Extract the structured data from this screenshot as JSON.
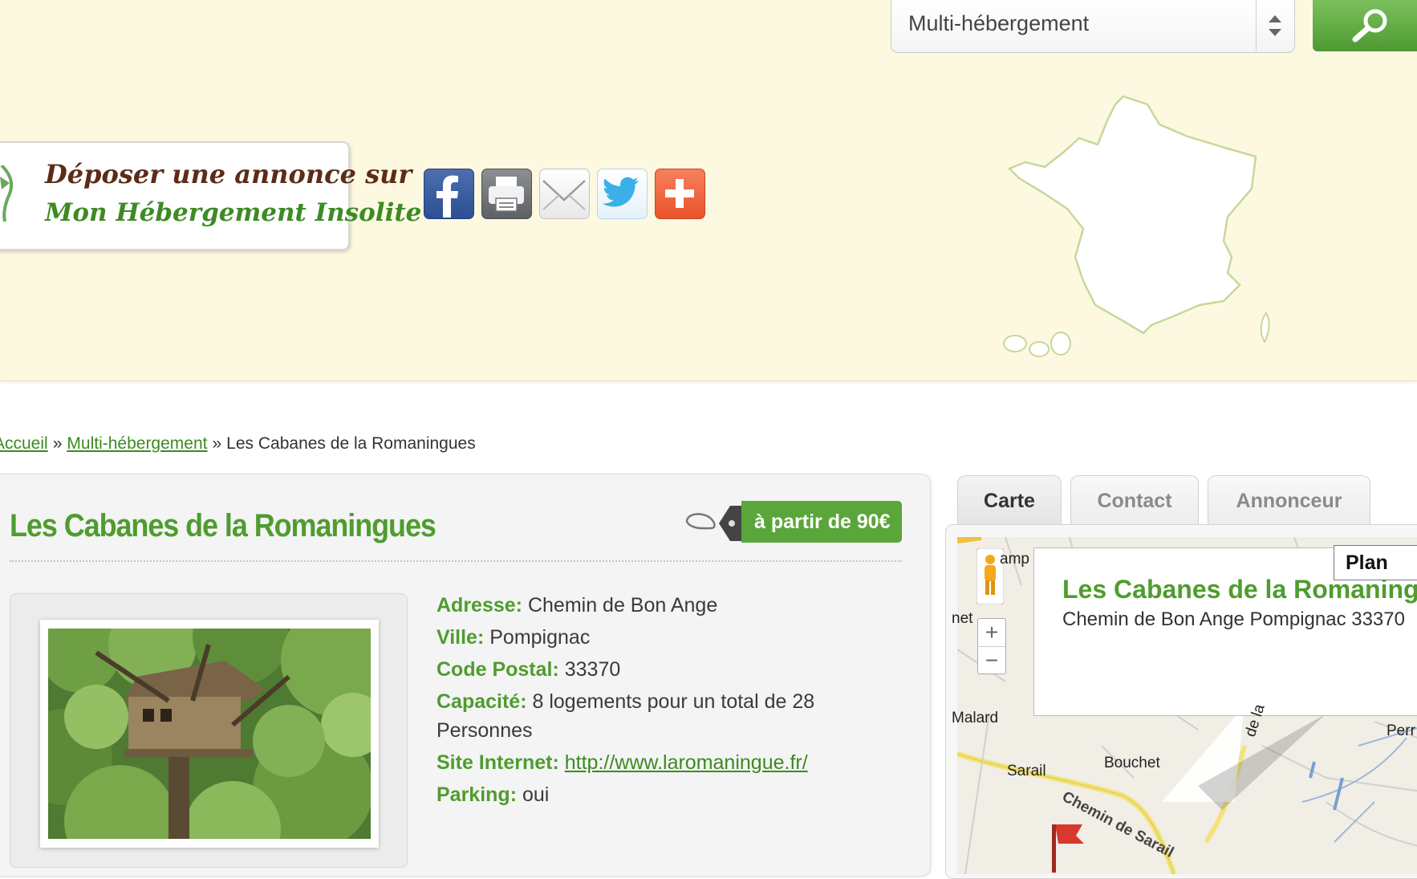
{
  "search": {
    "selected_category": "Multi-hébergement",
    "button_icon": "magnifier-icon"
  },
  "promo": {
    "line1": "Déposer une annonce sur",
    "line2": "Mon Hébergement Insolite"
  },
  "share": {
    "icons": [
      "facebook-icon",
      "print-icon",
      "email-icon",
      "twitter-icon",
      "more-icon"
    ]
  },
  "breadcrumb": {
    "home": "Accueil",
    "category": "Multi-hébergement",
    "current": "Les Cabanes de la Romaningues",
    "separator": "»"
  },
  "listing": {
    "title": "Les Cabanes de la Romaningues",
    "price": "à partir de 90€",
    "details": [
      {
        "label": "Adresse:",
        "value": "Chemin de Bon Ange"
      },
      {
        "label": "Ville:",
        "value": "Pompignac"
      },
      {
        "label": "Code Postal:",
        "value": "33370"
      },
      {
        "label": "Capacité:",
        "value": "8 logements pour un total de 28 Personnes"
      },
      {
        "label": "Site Internet:",
        "value": "http://www.laromaningue.fr/"
      },
      {
        "label": "Parking:",
        "value": "oui"
      }
    ]
  },
  "tabs": [
    {
      "label": "Carte",
      "active": true
    },
    {
      "label": "Contact",
      "active": false
    },
    {
      "label": "Annonceur",
      "active": false
    }
  ],
  "map": {
    "plan_label": "Plan",
    "zoom_in": "+",
    "zoom_out": "−",
    "info_title": "Les Cabanes de la Romaningues",
    "info_address": "Chemin de Bon Ange Pompignac  33370",
    "places": [
      "amp",
      "net",
      "Malard",
      "Sarail",
      "Bouchet",
      "Chemin de Sarail",
      "Perr",
      "de la"
    ]
  },
  "colors": {
    "header_bg": "#fdf9e1",
    "brand_green": "#4f9c2f",
    "link_green": "#3c8a22",
    "promo_brown": "#5c2c17"
  }
}
